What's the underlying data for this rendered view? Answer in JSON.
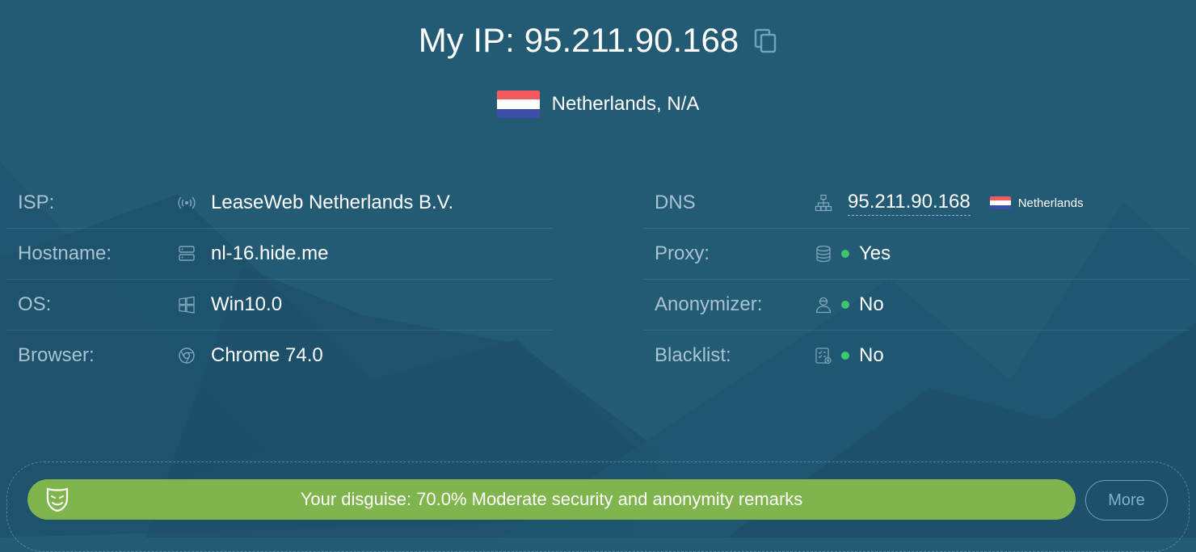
{
  "header": {
    "title_prefix": "My IP:",
    "ip": "95.211.90.168",
    "location": "Netherlands, N/A"
  },
  "left_rows": [
    {
      "label": "ISP:",
      "icon": "antenna-icon",
      "value": "LeaseWeb Netherlands B.V."
    },
    {
      "label": "Hostname:",
      "icon": "server-icon",
      "value": "nl-16.hide.me"
    },
    {
      "label": "OS:",
      "icon": "windows-icon",
      "value": "Win10.0"
    },
    {
      "label": "Browser:",
      "icon": "chrome-icon",
      "value": "Chrome 74.0"
    }
  ],
  "right_rows": [
    {
      "label": "DNS",
      "icon": "network-icon",
      "value": "95.211.90.168",
      "country": "Netherlands"
    },
    {
      "label": "Proxy:",
      "icon": "database-icon",
      "value": "Yes"
    },
    {
      "label": "Anonymizer:",
      "icon": "user-mask-icon",
      "value": "No"
    },
    {
      "label": "Blacklist:",
      "icon": "checklist-icon",
      "value": "No"
    }
  ],
  "status": {
    "text": "Your disguise: 70.0% Moderate security and anonymity remarks",
    "score_percent": 70.0,
    "bar_color": "#80b44c",
    "indicator_color": "#40c66e"
  },
  "more_button": "More",
  "flag_colors": [
    "#f25a5e",
    "#ffffff",
    "#3c4fa8"
  ]
}
